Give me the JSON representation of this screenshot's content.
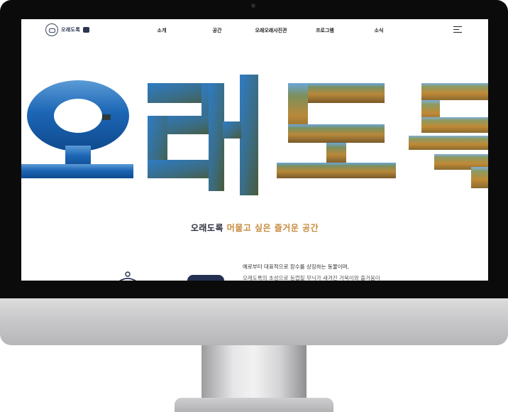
{
  "logo": {
    "text": "오래도록",
    "badge": ""
  },
  "nav": {
    "items": [
      {
        "label": "소개"
      },
      {
        "label": "공간"
      },
      {
        "label": "오래오래사진관"
      },
      {
        "label": "프로그램"
      },
      {
        "label": "소식"
      }
    ],
    "menu_icon": "hamburger-menu-icon"
  },
  "hero": {
    "letters": [
      "오",
      "래",
      "도",
      "록"
    ]
  },
  "tagline": {
    "part1": "오래도록",
    "part2": "머물고 싶은 즐거운 공간"
  },
  "description": {
    "line1": "예로부터 대표적으로 장수를 상징하는 동물이며,",
    "line2": "오래도록의 초성으로 등껍질 무늬가 새겨진 거북이와 즐거움이"
  },
  "colors": {
    "accent": "#c98b3f",
    "navy": "#243052",
    "sea": "#1b63b0",
    "grass": "#b88a3a"
  }
}
